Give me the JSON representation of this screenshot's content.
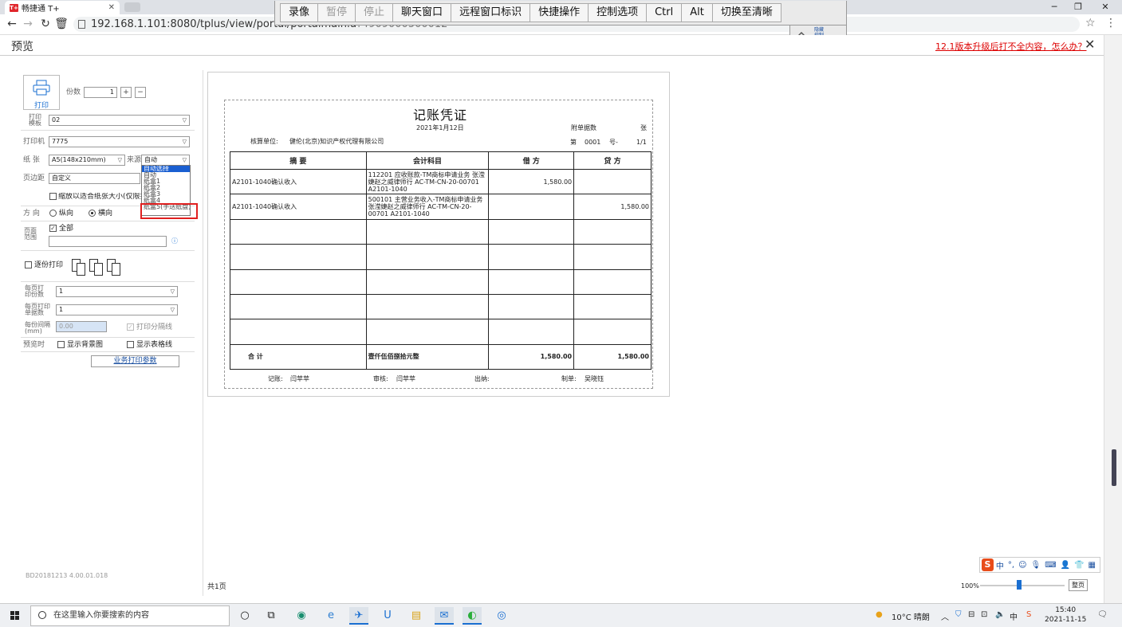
{
  "browser": {
    "tab_title": "畅捷通 T+",
    "tab_favicon": "T+",
    "url": "192.168.1.101:8080/tplus/view/portal/portalmain.a",
    "url_suffix": "?4909000500012"
  },
  "remote_toolbar": {
    "buttons": [
      "录像",
      "暂停",
      "停止",
      "聊天窗口",
      "远程窗口标识",
      "快捷操作",
      "控制选项",
      "Ctrl",
      "Alt",
      "切换至清晰"
    ],
    "disabled": [
      false,
      true,
      true,
      false,
      false,
      false,
      false,
      false,
      false,
      false
    ],
    "tab_label": "隐藏 控制"
  },
  "preview": {
    "title": "预览",
    "upgrade_link": "12.1版本升级后打不全内容，怎么办？"
  },
  "left_panel": {
    "print_button": "打印",
    "copies_label": "份数",
    "copies_value": "1",
    "plus": "+",
    "minus": "−",
    "template_label": "打印模板",
    "template_value": "02",
    "printer_label": "打印机",
    "printer_value": "7775",
    "paper_label": "纸 张",
    "paper_value": "A5(148x210mm)",
    "source_label": "来源",
    "source_value": "自动",
    "source_options": [
      "自动选择",
      "自动",
      "纸盒1",
      "纸盒2",
      "纸盒3",
      "纸盒4",
      "纸盒5(手送纸盘)"
    ],
    "margin_label": "页边距",
    "margin_value": "自定义",
    "shrink_label": "缩放以适合纸张大小(仅限打印)",
    "orientation_label": "方 向",
    "portrait": "纵向",
    "landscape": "横向",
    "range_label": "页面范围",
    "all_pages": "全部",
    "collate_label": "逐份打印",
    "per_page_copies_label": "每页打印份数",
    "per_page_copies_value": "1",
    "per_page_docs_label": "每页打印单据数",
    "per_page_docs_value": "1",
    "spacing_label": "每份间隔(mm)",
    "spacing_value": "0.00",
    "separator_label": "打印分隔线",
    "preview_label": "预览时",
    "show_bg": "显示背景图",
    "show_grid": "显示表格线",
    "biz_params": "业务打印参数",
    "build": "BD20181213 4.00.01.018"
  },
  "voucher": {
    "title": "记账凭证",
    "date": "2021年1月12日",
    "attach_label": "附单据数",
    "attach_unit": "张",
    "org_label": "核算单位:",
    "org_value": "健伦(北京)知识产权代理有限公司",
    "no_label": "第",
    "no_value": "0001",
    "no_suffix": "号-",
    "page": "1/1",
    "headers": [
      "摘 要",
      "会计科目",
      "借 方",
      "贷 方"
    ],
    "rows": [
      {
        "summary": "A2101-1040确认收入",
        "subject": "112201 应收账款-TM商标申请业务 张滢婕赵之威律师行 AC-TM-CN-20-00701 A2101-1040",
        "debit": "1,580.00",
        "credit": ""
      },
      {
        "summary": "A2101-1040确认收入",
        "subject": "500101 主营业务收入-TM商标申请业务 张滢婕赵之威律师行 AC-TM-CN-20-00701 A2101-1040",
        "debit": "",
        "credit": "1,580.00"
      }
    ],
    "total_label": "合 计",
    "total_words": "壹仟伍佰捌拾元整",
    "total_debit": "1,580.00",
    "total_credit": "1,580.00",
    "bookkeeper_label": "记账:",
    "bookkeeper": "闫苹苹",
    "auditor_label": "审核:",
    "auditor": "闫苹苹",
    "cashier_label": "出纳:",
    "maker_label": "制单:",
    "maker": "吴晓钰"
  },
  "footer": {
    "page_count": "共1页",
    "zoom": "100%",
    "fit": "整页"
  },
  "taskbar": {
    "search_placeholder": "在这里输入你要搜索的内容",
    "weather": "10°C 晴朗",
    "time": "15:40",
    "date": "2021-11-15",
    "ime": "中"
  }
}
